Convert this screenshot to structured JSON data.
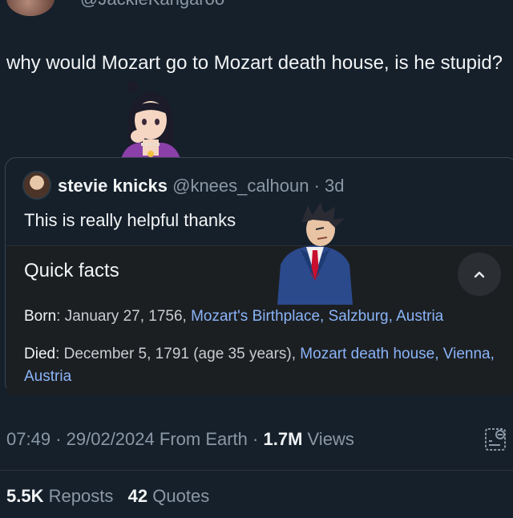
{
  "top": {
    "handle_partial": "@JackieKangaroo"
  },
  "tweet": {
    "text": "why would Mozart go to Mozart death house, is he stupid?"
  },
  "quoted": {
    "name": "stevie knicks",
    "handle": "@knees_calhoun",
    "separator": "·",
    "age": "3d",
    "text": "This is really helpful thanks",
    "panel": {
      "title": "Quick facts",
      "born_label": "Born",
      "born_text": ": January 27, 1756, ",
      "born_link": "Mozart's Birthplace, Salzburg, Austria",
      "died_label": "Died",
      "died_text": ": December 5, 1791 (age 35 years), ",
      "died_link": "Mozart death house, Vienna, Austria"
    }
  },
  "meta": {
    "time": "07:49",
    "sep1": "·",
    "date": "29/02/2024",
    "source": "From Earth",
    "sep2": "·",
    "views_count": "1.7M",
    "views_label": "Views"
  },
  "stats": {
    "reposts_count": "5.5K",
    "reposts_label": "Reposts",
    "quotes_count": "42",
    "quotes_label": "Quotes"
  },
  "colors": {
    "background": "#15202b",
    "link": "#8ab4f8",
    "secondary_text": "#8b98a5"
  },
  "icons": [
    "collapse-chevron-up-icon",
    "analytics-icon"
  ]
}
